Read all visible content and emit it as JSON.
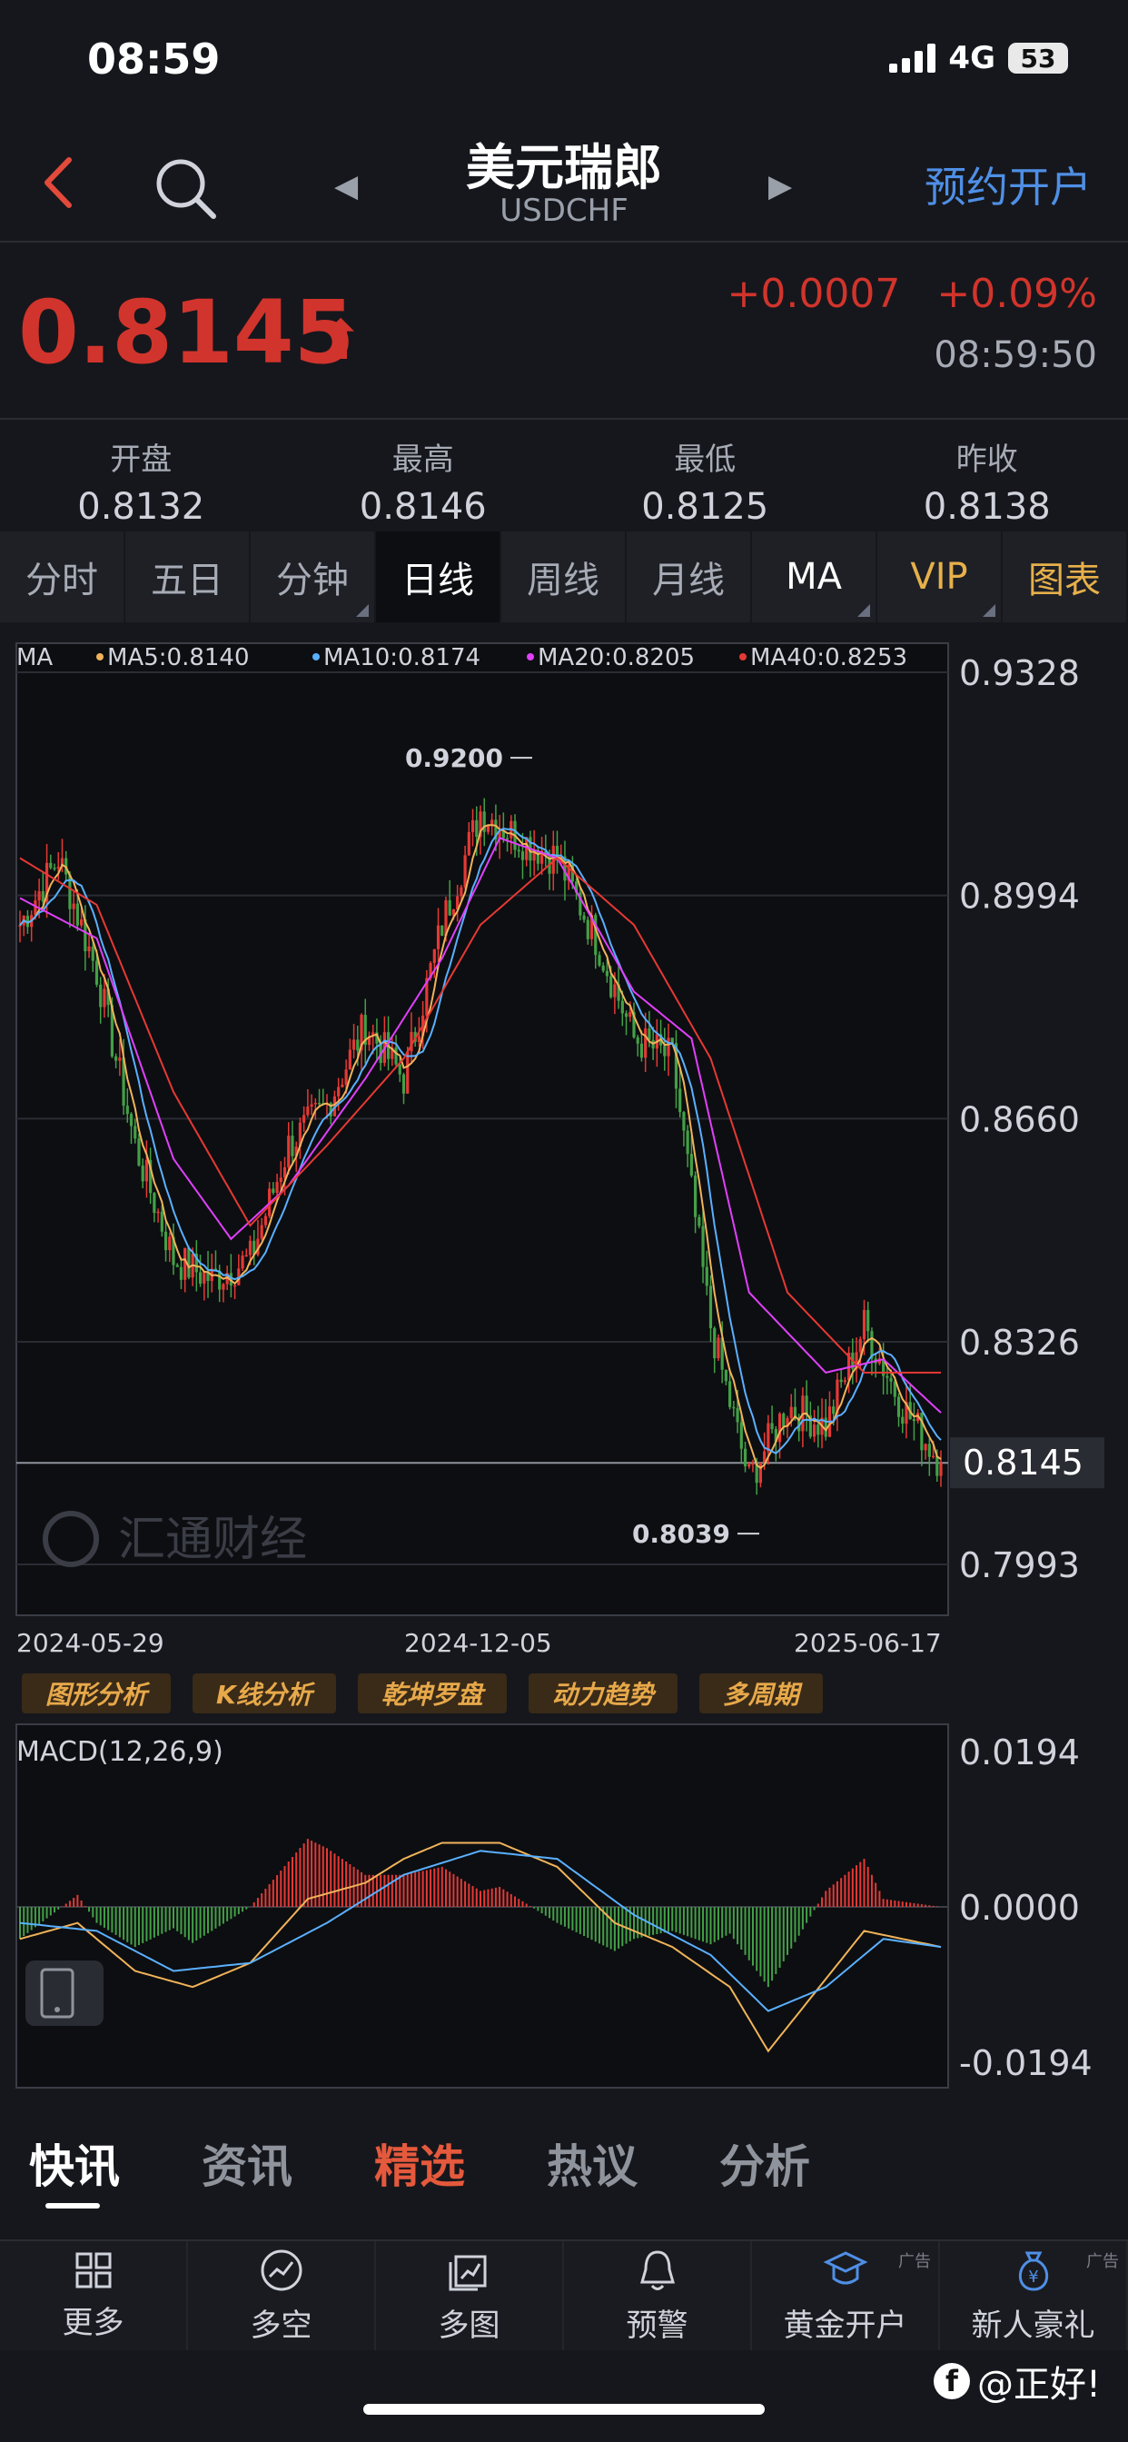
{
  "status": {
    "time": "08:59",
    "network": "4G",
    "battery": "53"
  },
  "nav": {
    "back_icon": "chevron-left-icon",
    "title": "美元瑞郎",
    "subtitle": "USDCHF",
    "reserve": "预约开户"
  },
  "quote": {
    "price": "0.8145",
    "change": "+0.0007",
    "change_pct": "+0.09%",
    "time": "08:59:50",
    "up_color": "#d1342c"
  },
  "ohlc": [
    {
      "label": "开盘",
      "value": "0.8132"
    },
    {
      "label": "最高",
      "value": "0.8146"
    },
    {
      "label": "最低",
      "value": "0.8125"
    },
    {
      "label": "昨收",
      "value": "0.8138"
    }
  ],
  "tabs": [
    "分时",
    "五日",
    "分钟",
    "日线",
    "周线",
    "月线",
    "MA",
    "VIP",
    "图表"
  ],
  "chart_data": {
    "type": "candlestick",
    "ma_label": "MA",
    "ma_legend": [
      {
        "name": "MA5:0.8140",
        "color": "#f0b35a"
      },
      {
        "name": "MA10:0.8174",
        "color": "#5ab0ff"
      },
      {
        "name": "MA20:0.8205",
        "color": "#e040fb"
      },
      {
        "name": "MA40:0.8253",
        "color": "#e53935"
      }
    ],
    "y_ticks": [
      "0.9328",
      "0.8994",
      "0.8660",
      "0.8326",
      "0.7993"
    ],
    "ylim": [
      0.7993,
      0.9328
    ],
    "current_label": "0.8145",
    "current_value": 0.8145,
    "high_label": "0.9200",
    "high_value": 0.92,
    "low_label": "0.8039",
    "low_value": 0.8039,
    "x_labels": [
      "2024-05-29",
      "2024-12-05",
      "2025-06-17"
    ],
    "close_path": [
      [
        0,
        0.895
      ],
      [
        10,
        0.905
      ],
      [
        20,
        0.888
      ],
      [
        30,
        0.862
      ],
      [
        40,
        0.845
      ],
      [
        50,
        0.842
      ],
      [
        60,
        0.845
      ],
      [
        70,
        0.862
      ],
      [
        80,
        0.868
      ],
      [
        90,
        0.88
      ],
      [
        100,
        0.872
      ],
      [
        110,
        0.895
      ],
      [
        120,
        0.912
      ],
      [
        130,
        0.908
      ],
      [
        140,
        0.905
      ],
      [
        150,
        0.893
      ],
      [
        160,
        0.878
      ],
      [
        170,
        0.875
      ],
      [
        180,
        0.835
      ],
      [
        190,
        0.812
      ],
      [
        200,
        0.823
      ],
      [
        210,
        0.82
      ],
      [
        220,
        0.835
      ],
      [
        230,
        0.823
      ],
      [
        240,
        0.8145
      ]
    ],
    "ma20_path": [
      [
        0,
        0.899
      ],
      [
        20,
        0.893
      ],
      [
        40,
        0.86
      ],
      [
        55,
        0.848
      ],
      [
        70,
        0.856
      ],
      [
        90,
        0.872
      ],
      [
        110,
        0.89
      ],
      [
        125,
        0.908
      ],
      [
        140,
        0.905
      ],
      [
        160,
        0.885
      ],
      [
        175,
        0.878
      ],
      [
        190,
        0.84
      ],
      [
        210,
        0.828
      ],
      [
        225,
        0.83
      ],
      [
        240,
        0.822
      ]
    ],
    "ma40_path": [
      [
        0,
        0.905
      ],
      [
        20,
        0.898
      ],
      [
        40,
        0.87
      ],
      [
        60,
        0.85
      ],
      [
        80,
        0.862
      ],
      [
        100,
        0.875
      ],
      [
        120,
        0.895
      ],
      [
        140,
        0.905
      ],
      [
        160,
        0.895
      ],
      [
        180,
        0.875
      ],
      [
        200,
        0.84
      ],
      [
        220,
        0.828
      ],
      [
        240,
        0.828
      ]
    ],
    "macd": {
      "label": "MACD(12,26,9)",
      "y_ticks": [
        "0.0194",
        "0.0000",
        "-0.0194"
      ],
      "ylim": [
        -0.0194,
        0.0194
      ],
      "dif": [
        [
          0,
          -0.004
        ],
        [
          15,
          -0.002
        ],
        [
          30,
          -0.008
        ],
        [
          45,
          -0.01
        ],
        [
          60,
          -0.007
        ],
        [
          75,
          0.001
        ],
        [
          90,
          0.003
        ],
        [
          100,
          0.006
        ],
        [
          110,
          0.008
        ],
        [
          125,
          0.008
        ],
        [
          140,
          0.005
        ],
        [
          155,
          -0.002
        ],
        [
          170,
          -0.005
        ],
        [
          185,
          -0.01
        ],
        [
          195,
          -0.018
        ],
        [
          205,
          -0.012
        ],
        [
          220,
          -0.003
        ],
        [
          240,
          -0.005
        ]
      ],
      "dea": [
        [
          0,
          -0.002
        ],
        [
          20,
          -0.003
        ],
        [
          40,
          -0.008
        ],
        [
          60,
          -0.007
        ],
        [
          80,
          -0.002
        ],
        [
          100,
          0.004
        ],
        [
          120,
          0.007
        ],
        [
          140,
          0.006
        ],
        [
          160,
          -0.001
        ],
        [
          180,
          -0.006
        ],
        [
          195,
          -0.013
        ],
        [
          210,
          -0.01
        ],
        [
          225,
          -0.004
        ],
        [
          240,
          -0.005
        ]
      ],
      "bar_color_pos": "#e53935",
      "bar_color_neg": "#43a047"
    }
  },
  "tools": [
    "图形分析",
    "K线分析",
    "乾坤罗盘",
    "动力趋势",
    "多周期"
  ],
  "news_tabs": [
    "快讯",
    "资讯",
    "精选",
    "热议",
    "分析"
  ],
  "bottom": [
    {
      "label": "更多",
      "icon": "grid-icon"
    },
    {
      "label": "多空",
      "icon": "gauge-icon"
    },
    {
      "label": "多图",
      "icon": "multi-chart-icon"
    },
    {
      "label": "预警",
      "icon": "bell-icon"
    },
    {
      "label": "黄金开户",
      "icon": "mortarboard-icon",
      "ad": "广告"
    },
    {
      "label": "新人豪礼",
      "icon": "money-bag-icon",
      "ad": "广告"
    }
  ],
  "watermark": "汇通财经",
  "corner_watermark": "@正好!"
}
